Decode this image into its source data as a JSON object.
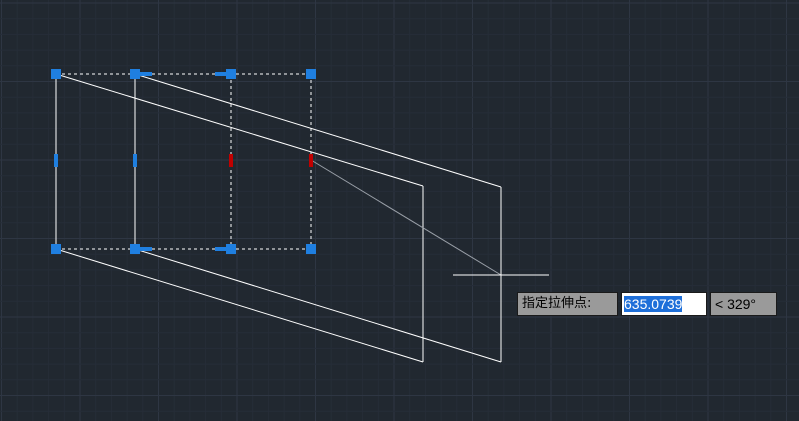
{
  "command": {
    "prompt": "指定拉伸点:",
    "distance_value": "635.0739",
    "angle_value": "< 329°"
  },
  "colors": {
    "background": "#212830",
    "grid_minor": "#262d38",
    "grid_major": "#2e3643",
    "geometry": "#ffffff",
    "grip": "#1f7fe0",
    "grip_hot": "#c00000",
    "rubber_band": "#9aa0a8"
  }
}
